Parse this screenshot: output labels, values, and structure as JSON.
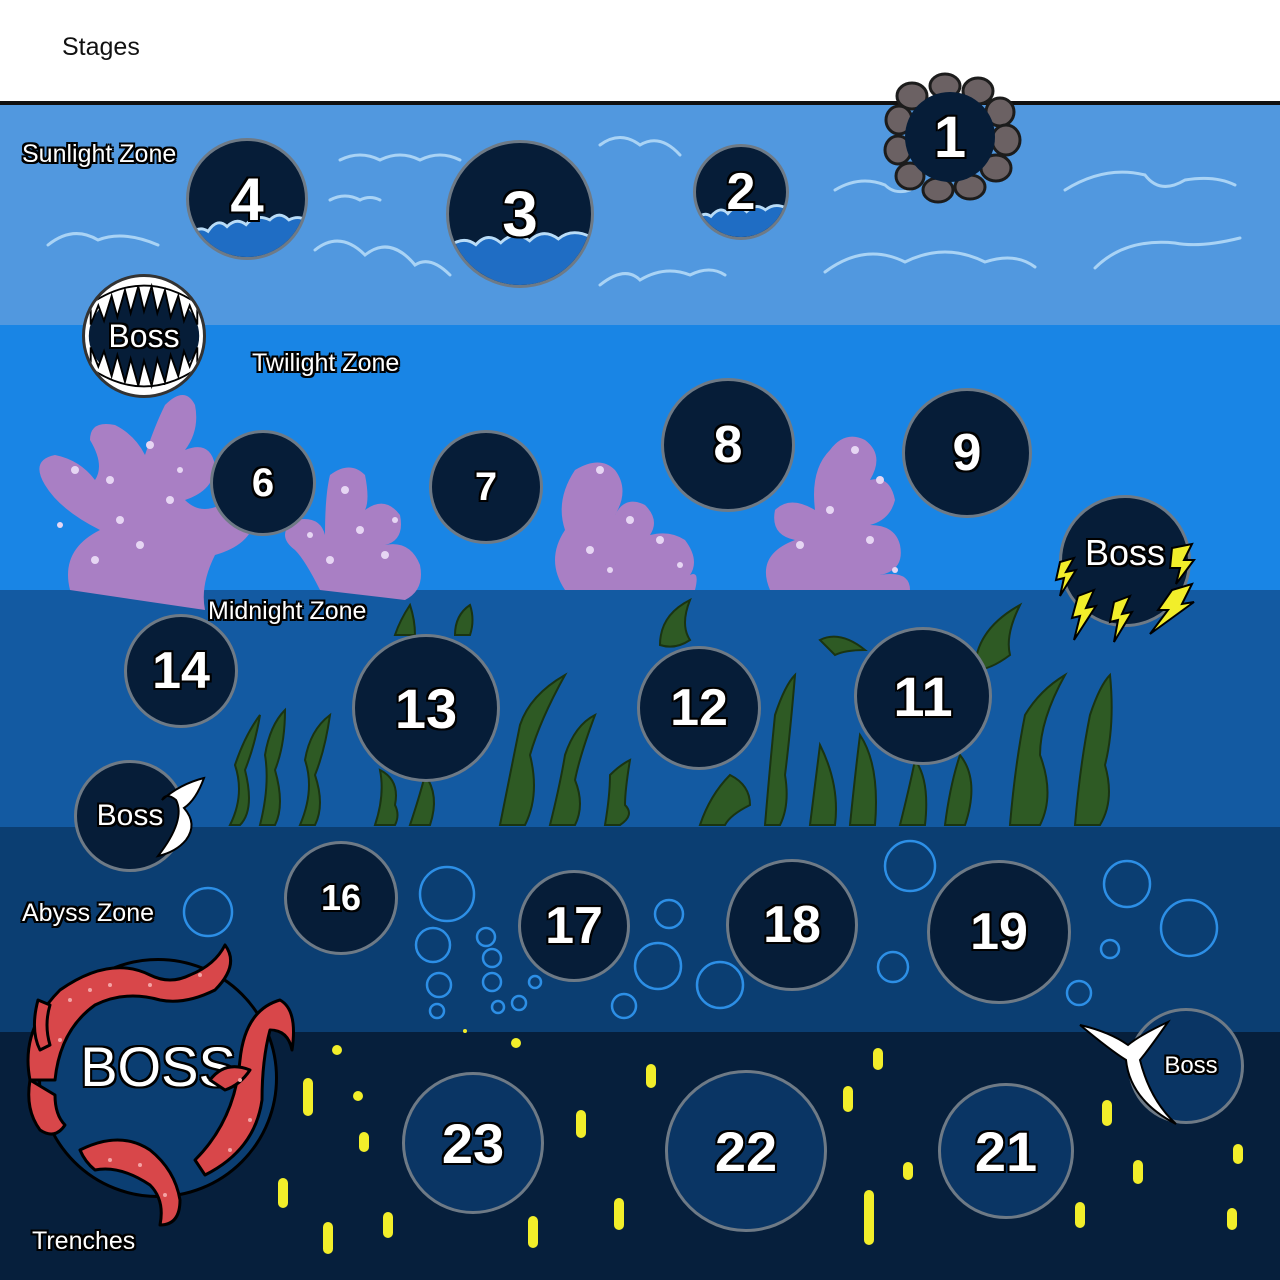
{
  "header": {
    "title": "Stages"
  },
  "zones": {
    "sunlight": "Sunlight Zone",
    "twilight": "Twilight Zone",
    "midnight": "Midnight Zone",
    "abyss": "Abyss Zone",
    "trenches": "Trenches"
  },
  "stages": {
    "s1": "1",
    "s2": "2",
    "s3": "3",
    "s4": "4",
    "s6": "6",
    "s7": "7",
    "s8": "8",
    "s9": "9",
    "s11": "11",
    "s12": "12",
    "s13": "13",
    "s14": "14",
    "s16": "16",
    "s17": "17",
    "s18": "18",
    "s19": "19",
    "s21": "21",
    "s22": "22",
    "s23": "23"
  },
  "bosses": {
    "shark": "Boss",
    "electric": "Boss",
    "whale_midnight": "Boss",
    "whale_trenches": "Boss",
    "kraken": "BOSS"
  },
  "colors": {
    "sunlight": "#5198df",
    "twilight": "#1985e5",
    "midnight": "#135aa2",
    "abyss": "#0b3e72",
    "trenches": "#061f3c",
    "stage_fill": "#061d38",
    "coral": "#a97fc4",
    "seaweed": "#2e5a24",
    "tentacle": "#d8474a",
    "glow": "#f2ee2a"
  },
  "icons": [
    "rock-ring-icon",
    "wave-icon",
    "shark-teeth-icon",
    "lightning-icon",
    "whale-tail-icon",
    "tentacle-icon",
    "bubble-icon",
    "coral-icon",
    "seaweed-icon"
  ]
}
